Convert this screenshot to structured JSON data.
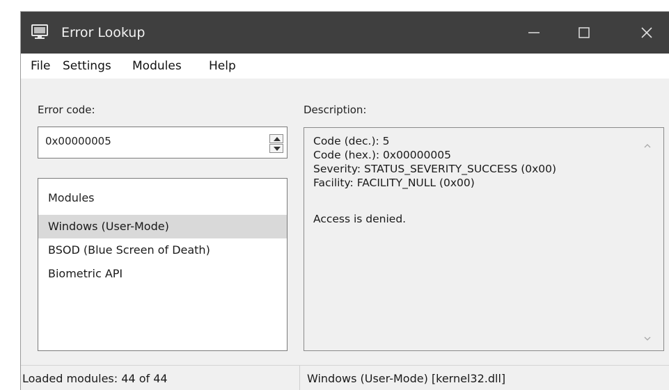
{
  "window": {
    "title": "Error Lookup"
  },
  "titlebar_icons": {
    "app": "computer-icon",
    "minimize": "minimize-icon",
    "maximize": "maximize-icon",
    "close": "close-icon"
  },
  "menu": {
    "items": [
      "File",
      "Settings",
      "Modules",
      "Help"
    ]
  },
  "error_code": {
    "label": "Error code:",
    "value": "0x00000005"
  },
  "modules_list": {
    "header": "Modules",
    "items": [
      "Windows (User-Mode)",
      "BSOD (Blue Screen of Death)",
      "Biometric API"
    ],
    "selected": "Windows (User-Mode)"
  },
  "description": {
    "label": "Description:",
    "lines": [
      "Code (dec.): 5",
      "Code (hex.): 0x00000005",
      "Severity: STATUS_SEVERITY_SUCCESS (0x00)",
      "Facility: FACILITY_NULL (0x00)",
      "",
      "Access is denied."
    ]
  },
  "status": {
    "left": "Loaded modules: 44 of 44",
    "right": "Windows (User-Mode) [kernel32.dll]"
  },
  "colors": {
    "titlebar": "#3f3f3f",
    "window_bg": "#f0f0f0",
    "selected_item": "#d9d9d9"
  }
}
